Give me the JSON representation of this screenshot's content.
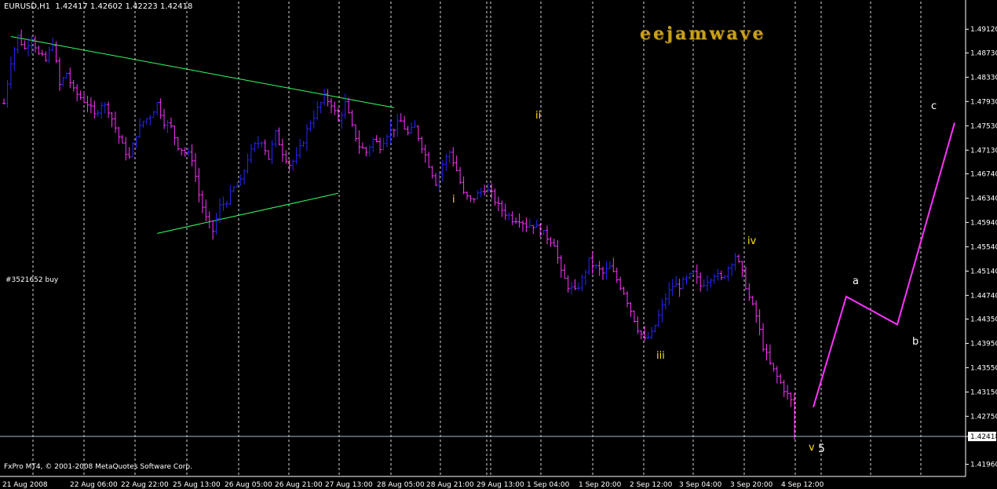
{
  "header": {
    "symbol": "EURUSD,H1",
    "ohlc": "1.42417 1.42602 1.42223 1.42418"
  },
  "brand_text": "eejamwave",
  "order_label": "#3521652 buy",
  "copyright": "FxPro MT4, © 2001-2008 MetaQuotes Software Corp.",
  "colors": {
    "background": "#000000",
    "grid": "#ffffff",
    "bull_bar": "#2626ff",
    "bear_bar": "#ff33ff",
    "trendline": "#33ff66",
    "wave_label": "#ffdd00",
    "projection": "#ff33ff",
    "bid_line": "#aab4cc",
    "axis_text": "#ffffff"
  },
  "chart_data": {
    "type": "candlestick-ohlc-bars",
    "symbol": "EURUSD",
    "timeframe": "H1",
    "title": "EURUSD,H1 1.42417 1.42602 1.42223 1.42418",
    "y_ticks": [
      "1.49120",
      "1.48730",
      "1.48330",
      "1.47930",
      "1.47530",
      "1.47130",
      "1.46740",
      "1.46340",
      "1.45940",
      "1.45540",
      "1.45140",
      "1.44740",
      "1.44350",
      "1.43950",
      "1.43550",
      "1.43150",
      "1.42750",
      "1.42418",
      "1.41960"
    ],
    "ylim": [
      1.4176,
      1.4942
    ],
    "current_price": "1.42418",
    "x_ticks": [
      "21 Aug 2008",
      "22 Aug 06:00",
      "22 Aug 22:00",
      "25 Aug 13:00",
      "26 Aug 05:00",
      "26 Aug 21:00",
      "27 Aug 13:00",
      "28 Aug 05:00",
      "28 Aug 21:00",
      "29 Aug 13:00",
      "1 Sep 04:00",
      "1 Sep 20:00",
      "2 Sep 12:00",
      "3 Sep 04:00",
      "3 Sep 20:00",
      "4 Sep 12:00"
    ],
    "grid": "vertical dotted lines at each x tick",
    "price_path": [
      [
        0,
        1.479
      ],
      [
        2,
        1.486
      ],
      [
        4,
        1.49
      ],
      [
        6,
        1.488
      ],
      [
        8,
        1.49
      ],
      [
        10,
        1.487
      ],
      [
        12,
        1.486
      ],
      [
        14,
        1.489
      ],
      [
        16,
        1.482
      ],
      [
        18,
        1.484
      ],
      [
        20,
        1.481
      ],
      [
        22,
        1.48
      ],
      [
        24,
        1.479
      ],
      [
        26,
        1.477
      ],
      [
        28,
        1.479
      ],
      [
        30,
        1.478
      ],
      [
        32,
        1.475
      ],
      [
        34,
        1.472
      ],
      [
        36,
        1.47
      ],
      [
        38,
        1.474
      ],
      [
        40,
        1.476
      ],
      [
        42,
        1.477
      ],
      [
        44,
        1.479
      ],
      [
        46,
        1.476
      ],
      [
        48,
        1.475
      ],
      [
        50,
        1.472
      ],
      [
        52,
        1.471
      ],
      [
        54,
        1.47
      ],
      [
        56,
        1.464
      ],
      [
        58,
        1.46
      ],
      [
        60,
        1.458
      ],
      [
        62,
        1.462
      ],
      [
        64,
        1.463
      ],
      [
        66,
        1.465
      ],
      [
        68,
        1.466
      ],
      [
        70,
        1.47
      ],
      [
        72,
        1.472
      ],
      [
        74,
        1.473
      ],
      [
        76,
        1.47
      ],
      [
        78,
        1.474
      ],
      [
        80,
        1.471
      ],
      [
        82,
        1.469
      ],
      [
        84,
        1.47
      ],
      [
        86,
        1.473
      ],
      [
        88,
        1.476
      ],
      [
        90,
        1.478
      ],
      [
        92,
        1.48
      ],
      [
        94,
        1.479
      ],
      [
        96,
        1.476
      ],
      [
        98,
        1.479
      ],
      [
        100,
        1.475
      ],
      [
        102,
        1.472
      ],
      [
        104,
        1.471
      ],
      [
        106,
        1.473
      ],
      [
        108,
        1.472
      ],
      [
        110,
        1.474
      ],
      [
        112,
        1.475
      ],
      [
        114,
        1.476
      ],
      [
        116,
        1.474
      ],
      [
        118,
        1.475
      ],
      [
        120,
        1.472
      ],
      [
        122,
        1.469
      ],
      [
        124,
        1.466
      ],
      [
        126,
        1.469
      ],
      [
        128,
        1.471
      ],
      [
        130,
        1.468
      ],
      [
        132,
        1.464
      ],
      [
        134,
        1.463
      ],
      [
        136,
        1.464
      ],
      [
        138,
        1.465
      ],
      [
        140,
        1.464
      ],
      [
        142,
        1.462
      ],
      [
        144,
        1.461
      ],
      [
        146,
        1.46
      ],
      [
        148,
        1.46
      ],
      [
        150,
        1.459
      ],
      [
        152,
        1.459
      ],
      [
        154,
        1.458
      ],
      [
        156,
        1.457
      ],
      [
        158,
        1.456
      ],
      [
        160,
        1.451
      ],
      [
        162,
        1.449
      ],
      [
        164,
        1.448
      ],
      [
        166,
        1.45
      ],
      [
        168,
        1.453
      ],
      [
        170,
        1.452
      ],
      [
        172,
        1.451
      ],
      [
        174,
        1.452
      ],
      [
        176,
        1.45
      ],
      [
        178,
        1.448
      ],
      [
        180,
        1.445
      ],
      [
        182,
        1.442
      ],
      [
        184,
        1.44
      ],
      [
        186,
        1.441
      ],
      [
        188,
        1.444
      ],
      [
        190,
        1.447
      ],
      [
        192,
        1.449
      ],
      [
        194,
        1.449
      ],
      [
        196,
        1.45
      ],
      [
        198,
        1.451
      ],
      [
        200,
        1.449
      ],
      [
        202,
        1.45
      ],
      [
        204,
        1.451
      ],
      [
        206,
        1.45
      ],
      [
        208,
        1.452
      ],
      [
        210,
        1.454
      ],
      [
        212,
        1.451
      ],
      [
        214,
        1.447
      ],
      [
        216,
        1.444
      ],
      [
        218,
        1.439
      ],
      [
        220,
        1.436
      ],
      [
        222,
        1.434
      ],
      [
        224,
        1.432
      ],
      [
        226,
        1.43
      ],
      [
        227,
        1.4242
      ]
    ],
    "trendlines": [
      {
        "from": [
          2,
          1.49
        ],
        "to": [
          112,
          1.4783
        ]
      },
      {
        "from": [
          44,
          1.4576
        ],
        "to": [
          96,
          1.4642
        ]
      }
    ],
    "wave_labels": [
      {
        "text": "i",
        "bar": 106,
        "price": 1.463
      },
      {
        "text": "ii",
        "bar": 125,
        "price": 1.4763
      },
      {
        "text": "iii",
        "bar": 154,
        "price": 1.4385
      },
      {
        "text": "iv",
        "bar": 175,
        "price": 1.4568
      },
      {
        "text": "v",
        "bar": 190,
        "price": 1.4243
      },
      {
        "text": "5",
        "bar": 192,
        "price": 1.4243
      },
      {
        "text": "a",
        "bar": 200,
        "price": 1.449
      },
      {
        "text": "b",
        "bar": 215,
        "price": 1.441
      },
      {
        "text": "c",
        "bar": 220,
        "price": 1.479
      }
    ],
    "projection_path": [
      [
        1036,
        1.429
      ],
      [
        1078,
        1.4472
      ],
      [
        1143,
        1.4426
      ],
      [
        1216,
        1.4758
      ]
    ]
  }
}
